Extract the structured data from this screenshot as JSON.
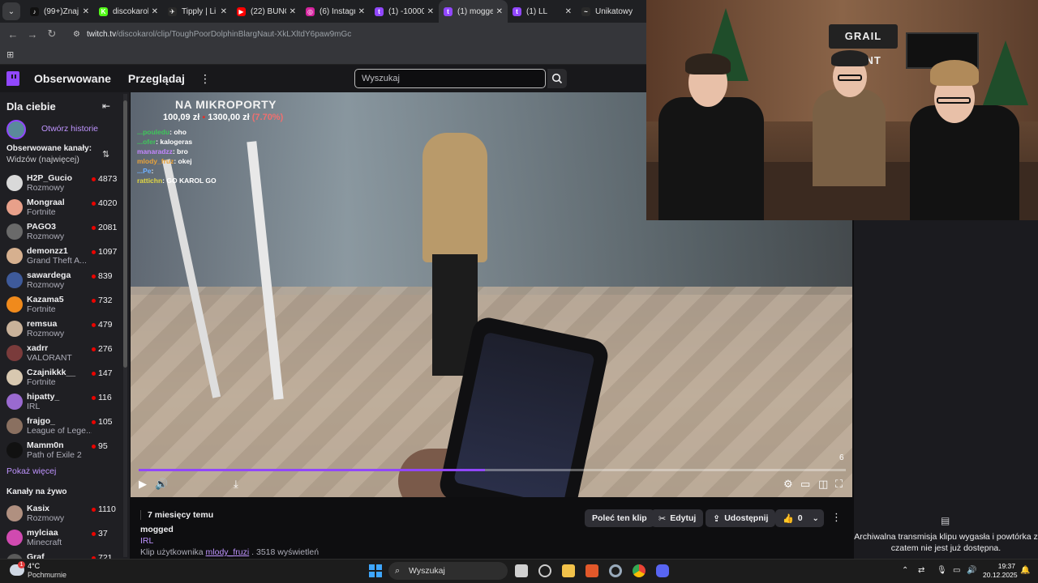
{
  "browser": {
    "tabs": [
      {
        "label": "(99+)Znaj",
        "color": "#111111",
        "glyph": "♪",
        "active": false
      },
      {
        "label": "discokarol",
        "color": "#53fc18",
        "glyph": "K",
        "active": false
      },
      {
        "label": "Tipply | Li",
        "color": "#2a2a2a",
        "glyph": "✈",
        "active": false
      },
      {
        "label": "(22) BUNG",
        "color": "#ff0000",
        "glyph": "▶",
        "active": false
      },
      {
        "label": "(6) Instagr",
        "color": "#d6249f",
        "glyph": "◎",
        "active": false
      },
      {
        "label": "(1) -10000",
        "color": "#9147ff",
        "glyph": "t",
        "active": false
      },
      {
        "label": "(1) mogge",
        "color": "#9147ff",
        "glyph": "t",
        "active": true
      },
      {
        "label": "(1) LL",
        "color": "#9147ff",
        "glyph": "t",
        "active": false
      },
      {
        "label": "Unikatowy",
        "color": "#2a2a2a",
        "glyph": "~",
        "active": false
      }
    ],
    "url_host": "twitch.tv",
    "url_path": "/discokarol/clip/ToughPoorDolphinBlargNaut-XkLXltdY6paw9mGc"
  },
  "twitch_nav": {
    "following": "Obserwowane",
    "browse": "Przeglądaj",
    "more": "⋮",
    "search_placeholder": "Wyszukaj"
  },
  "sidebar": {
    "header": "Dla ciebie",
    "story_label": "Otwórz historie",
    "followed_title": "Obserwowane kanały:",
    "followed_sort": "Widzów (najwięcej)",
    "followed": [
      {
        "name": "H2P_Gucio",
        "game": "Rozmowy",
        "viewers": "4873",
        "color": "#d9d9d9"
      },
      {
        "name": "Mongraal",
        "game": "Fortnite",
        "viewers": "4020",
        "color": "#e8a08a"
      },
      {
        "name": "PAGO3",
        "game": "Rozmowy",
        "viewers": "2081",
        "color": "#6a6a6a"
      },
      {
        "name": "demonzz1",
        "game": "Grand Theft A...",
        "viewers": "1097",
        "color": "#d6b08f"
      },
      {
        "name": "sawardega",
        "game": "Rozmowy",
        "viewers": "839",
        "color": "#3e5a9a"
      },
      {
        "name": "Kazama5",
        "game": "Fortnite",
        "viewers": "732",
        "color": "#f08a1c"
      },
      {
        "name": "remsua",
        "game": "Rozmowy",
        "viewers": "479",
        "color": "#c9b29a"
      },
      {
        "name": "xadrr",
        "game": "VALORANT",
        "viewers": "276",
        "color": "#7a3b3b"
      },
      {
        "name": "Czajnikkk__",
        "game": "Fortnite",
        "viewers": "147",
        "color": "#d8c8b0"
      },
      {
        "name": "hipatty_",
        "game": "IRL",
        "viewers": "116",
        "color": "#9a6ad0"
      },
      {
        "name": "frajgo_",
        "game": "League of Lege...",
        "viewers": "105",
        "color": "#8a7060"
      },
      {
        "name": "Mamm0n",
        "game": "Path of Exile 2",
        "viewers": "95",
        "color": "#111111"
      }
    ],
    "show_more": "Pokaż więcej",
    "live_title": "Kanały na żywo",
    "live": [
      {
        "name": "Kasix",
        "game": "Rozmowy",
        "viewers": "1110",
        "color": "#b09080"
      },
      {
        "name": "mylciaa",
        "game": "Minecraft",
        "viewers": "37",
        "color": "#d04ab0"
      },
      {
        "name": "Graf",
        "game": "",
        "viewers": "721",
        "color": "#5a5a5a"
      }
    ]
  },
  "video": {
    "overlay_title": "NA MIKROPORTY",
    "donation_current": "100,09 zł",
    "donation_goal": "1300,00 zł",
    "donation_pct": "(7.70%)",
    "chat": [
      {
        "user": "...pouledu",
        "msg": "oho",
        "cls": "u"
      },
      {
        "user": "...ofer",
        "msg": "kalogeras",
        "cls": "u"
      },
      {
        "user": "manaradzz",
        "msg": "bro",
        "cls": "u p"
      },
      {
        "user": "mlody_fruz",
        "msg": "okej",
        "cls": "u o"
      },
      {
        "user": "...Pe",
        "msg": "",
        "cls": "u b"
      },
      {
        "user": "rattichn",
        "msg": "GO KAROL GO",
        "cls": "u y"
      }
    ],
    "progress_pct": 49,
    "time_label": "6"
  },
  "clip": {
    "ago": "7 miesięcy temu",
    "title": "mogged",
    "category": "IRL",
    "meta_prefix": "Klip użytkownika ",
    "meta_user": "mlody_fruzi",
    "meta_suffix": " . 3518 wyświetleń",
    "recommend": "Poleć ten klip",
    "edit": "Edytuj",
    "share": "Udostępnij",
    "likes": "0"
  },
  "cam": {
    "sign": "GRAIL POINT"
  },
  "right_pane": {
    "message": "Archiwalna transmisja klipu wygasła i powtórka z czatem nie jest już dostępna."
  },
  "taskbar": {
    "temp": "4°C",
    "weather": "Pochmurnie",
    "weather_badge": "1",
    "search": "Wyszukaj",
    "time": "19:37",
    "date": "20.12.2025"
  }
}
